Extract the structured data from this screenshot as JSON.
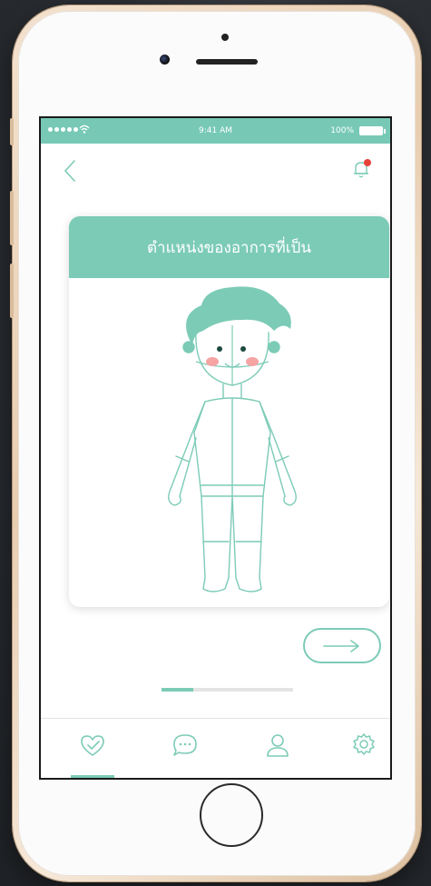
{
  "statusbar": {
    "time": "9:41 AM",
    "battery": "100%",
    "signal_icon": "signal-dots-icon",
    "wifi_icon": "wifi-icon"
  },
  "header": {
    "back_icon": "chevron-left-icon",
    "notification_icon": "bell-icon",
    "notification_badge_color": "#e8413a"
  },
  "card": {
    "title": "ตำแหน่งของอาการที่เป็น",
    "illustration": "body-figure-illustration"
  },
  "next_button": {
    "icon": "arrow-right-icon"
  },
  "progress": {
    "value": 0.24
  },
  "tabbar": {
    "items": [
      {
        "icon": "heart-check-icon",
        "active": true
      },
      {
        "icon": "chat-bubble-icon",
        "active": false
      },
      {
        "icon": "user-icon",
        "active": false
      },
      {
        "icon": "gear-icon",
        "active": false
      }
    ]
  },
  "colors": {
    "accent": "#7ccbb7",
    "statusbar": "#77c9b6",
    "cheek": "#f5a3a3",
    "hair": "#7ccbb7"
  }
}
